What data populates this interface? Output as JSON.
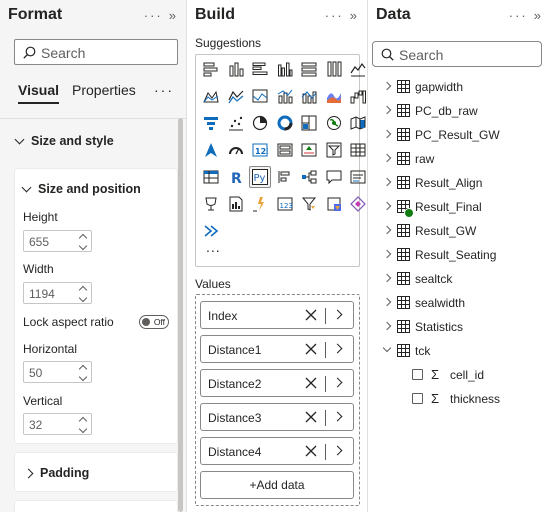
{
  "format": {
    "title": "Format",
    "search_placeholder": "Search",
    "tabs": [
      "Visual",
      "Properties"
    ],
    "section_size_style": "Size and style",
    "group_size_position": "Size and position",
    "height_label": "Height",
    "height_value": "655",
    "width_label": "Width",
    "width_value": "1194",
    "lock_label": "Lock aspect ratio",
    "lock_toggle": "Off",
    "horizontal_label": "Horizontal",
    "horizontal_value": "50",
    "vertical_label": "Vertical",
    "vertical_value": "32",
    "padding_label": "Padding"
  },
  "build": {
    "title": "Build",
    "suggestions_label": "Suggestions",
    "more_visuals": "...",
    "values_label": "Values",
    "values": [
      "Index",
      "Distance1",
      "Distance2",
      "Distance3",
      "Distance4"
    ],
    "add_data": "+Add data"
  },
  "data": {
    "title": "Data",
    "search_placeholder": "Search",
    "tables": [
      "gapwidth",
      "PC_db_raw",
      "PC_Result_GW",
      "raw",
      "Result_Align",
      "Result_Final",
      "Result_GW",
      "Result_Seating",
      "sealtck",
      "sealwidth",
      "Statistics",
      "tck"
    ],
    "tck_fields": [
      "cell_id",
      "thickness"
    ]
  },
  "colors": {
    "accent": "#107c10",
    "pane_bg": "#f5f5f5",
    "text": "#252423"
  }
}
